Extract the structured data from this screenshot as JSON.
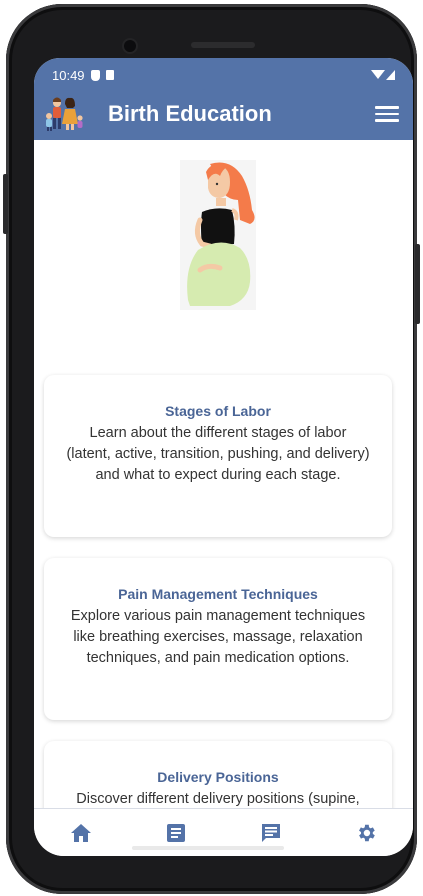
{
  "status_bar": {
    "time": "10:49"
  },
  "app_bar": {
    "title": "Birth Education",
    "menu_icon": "menu-icon"
  },
  "colors": {
    "primary": "#5473a8",
    "card_title": "#4a6596",
    "hero_hair": "#f47b4a",
    "hero_dress": "#d6ebb0"
  },
  "cards": [
    {
      "title": "Stages of Labor",
      "description": "Learn about the different stages of labor (latent, active, transition, pushing, and delivery) and what to expect during each stage."
    },
    {
      "title": "Pain Management Techniques",
      "description": "Explore various pain management techniques like breathing exercises, massage, relaxation techniques, and pain medication options."
    },
    {
      "title": "Delivery Positions",
      "description": "Discover different delivery positions (supine, side-lying, squatting, etc.) and their potential benefits."
    }
  ],
  "bottom_nav": [
    {
      "icon": "home-icon"
    },
    {
      "icon": "article-icon"
    },
    {
      "icon": "chat-icon"
    },
    {
      "icon": "settings-icon"
    }
  ]
}
